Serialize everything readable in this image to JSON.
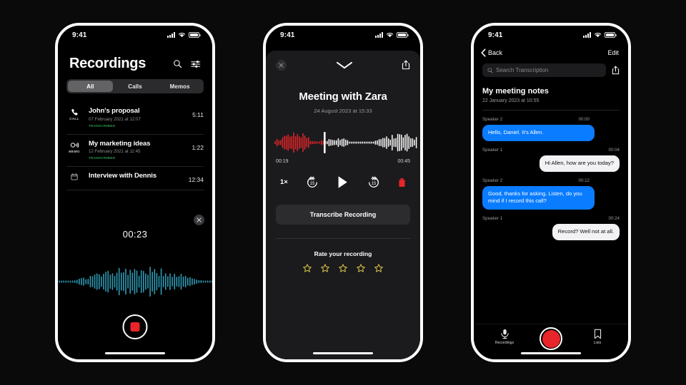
{
  "theme": {
    "background": "#0a0a0a",
    "screen_bg": "#000000",
    "sheet_bg": "#1b1b1d",
    "accent_red": "#e8252a",
    "accent_blue": "#0a7cff",
    "accent_green": "#2e9e4f",
    "accent_yellow": "#e8d44a",
    "waveform_teal": "#2f9bb5"
  },
  "status_bar": {
    "time": "9:41"
  },
  "phone1": {
    "title": "Recordings",
    "icons": {
      "search": "search-icon",
      "filter": "filter-sliders-icon"
    },
    "segments": [
      {
        "label": "All",
        "active": true
      },
      {
        "label": "Calls",
        "active": false
      },
      {
        "label": "Memos",
        "active": false
      }
    ],
    "recordings": [
      {
        "icon": "phone-call-icon",
        "icon_label": "CALL",
        "name": "John's proposal",
        "date": "07 February 2021 at 12:07",
        "tag": "TRANSCRIBED",
        "duration": "5:11"
      },
      {
        "icon": "voice-memo-icon",
        "icon_label": "MEMO",
        "name": "My marketing ideas",
        "date": "12 February 2021 at 11:45",
        "tag": "TRANSCRIBED",
        "duration": "1:22"
      },
      {
        "icon": "calendar-icon",
        "icon_label": "",
        "name": "Interview with Dennis",
        "date": "",
        "tag": "",
        "duration": "12:34"
      }
    ],
    "overlay": {
      "close_icon": "close-icon",
      "timer": "00:23",
      "stop_button": "stop-recording-button"
    }
  },
  "phone2": {
    "close_icon": "close-icon",
    "collapse_icon": "chevron-down-icon",
    "share_icon": "share-icon",
    "title": "Meeting with Zara",
    "subtitle": "24 August 2023 at 15:33",
    "elapsed": "00:19",
    "total": "00:45",
    "controls": {
      "speed": "1×",
      "rewind": "15",
      "forward": "15",
      "play_icon": "play-icon",
      "delete_icon": "trash-icon"
    },
    "transcribe_label": "Transcribe Recording",
    "rate_label": "Rate your recording",
    "stars_total": 5,
    "stars_filled": 0
  },
  "phone3": {
    "back_label": "Back",
    "edit_label": "Edit",
    "search_placeholder": "Search Transcription",
    "share_icon": "share-icon",
    "heading": "My meeting notes",
    "subheading": "22 January 2023 at 10:55",
    "turns": [
      {
        "speaker": "Speaker 2",
        "time": "00:00",
        "text": "Hello, Daniel. It's Allen.",
        "side": "left"
      },
      {
        "speaker": "Speaker 1",
        "time": "00:04",
        "text": "Hi Allen, how are you today?",
        "side": "right"
      },
      {
        "speaker": "Speaker 2",
        "time": "00:12",
        "text": "Good, thanks for asking. Listen, do you mind if I record this call?",
        "side": "left"
      },
      {
        "speaker": "Speaker 1",
        "time": "00:24",
        "text": "Record? Well not at all.",
        "side": "right"
      }
    ],
    "tabs": [
      {
        "label": "Recordings",
        "icon": "microphone-icon"
      },
      {
        "label": "Lists",
        "icon": "bookmark-icon"
      }
    ],
    "record_button": "record-button"
  }
}
